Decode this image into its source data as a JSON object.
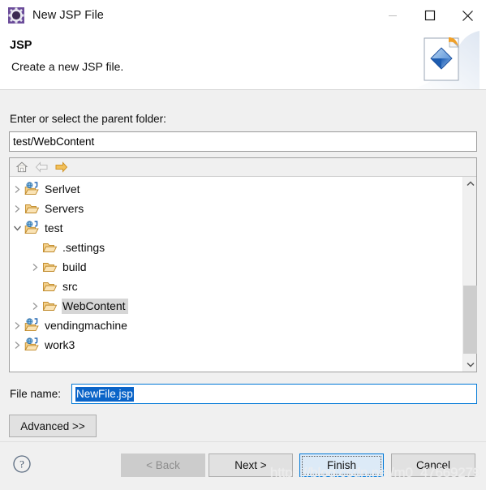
{
  "window": {
    "title": "New JSP File",
    "icon": "jsp-wizard-icon",
    "controls": [
      {
        "name": "minimize-button",
        "glyph": "minimize-icon",
        "enabled": false
      },
      {
        "name": "maximize-button",
        "glyph": "maximize-icon",
        "enabled": true
      },
      {
        "name": "close-button",
        "glyph": "close-icon",
        "enabled": true
      }
    ]
  },
  "banner": {
    "title": "JSP",
    "subtitle": "Create a new JSP file.",
    "icon": "jsp-file-banner-icon"
  },
  "form": {
    "parent_folder_label": "Enter or select the parent folder:",
    "parent_folder_value": "test/WebContent",
    "parent_folder_placeholder": "",
    "file_name_label": "File name:",
    "file_name_value": "NewFile.jsp",
    "file_name_placeholder": "",
    "advanced_label": "Advanced >>"
  },
  "tree": {
    "toolbar": [
      {
        "name": "home-icon",
        "label": "Home",
        "enabled": true
      },
      {
        "name": "back-arrow-icon",
        "label": "Back",
        "enabled": false
      },
      {
        "name": "forward-arrow-icon",
        "label": "Forward",
        "enabled": true
      }
    ],
    "nodes": [
      {
        "label": "Serlvet",
        "indent": 0,
        "twisty": "collapsed",
        "icon": "web-project-icon",
        "selected": false
      },
      {
        "label": "Servers",
        "indent": 0,
        "twisty": "collapsed",
        "icon": "folder-icon",
        "selected": false
      },
      {
        "label": "test",
        "indent": 0,
        "twisty": "expanded",
        "icon": "web-project-icon",
        "selected": false
      },
      {
        "label": ".settings",
        "indent": 1,
        "twisty": "none",
        "icon": "folder-icon",
        "selected": false
      },
      {
        "label": "build",
        "indent": 1,
        "twisty": "collapsed",
        "icon": "folder-icon",
        "selected": false
      },
      {
        "label": "src",
        "indent": 1,
        "twisty": "none",
        "icon": "folder-icon",
        "selected": false
      },
      {
        "label": "WebContent",
        "indent": 1,
        "twisty": "collapsed",
        "icon": "folder-icon",
        "selected": true
      },
      {
        "label": "vendingmachine",
        "indent": 0,
        "twisty": "collapsed",
        "icon": "web-project-icon",
        "selected": false
      },
      {
        "label": "work3",
        "indent": 0,
        "twisty": "collapsed",
        "icon": "web-project-icon",
        "selected": false
      }
    ],
    "scrollbar": {
      "up": "scroll-up-icon",
      "down": "scroll-down-icon"
    }
  },
  "footer": {
    "help": "?",
    "buttons": [
      {
        "name": "back-button",
        "label": "< Back",
        "enabled": false,
        "default": false
      },
      {
        "name": "next-button",
        "label": "Next >",
        "enabled": true,
        "default": false
      },
      {
        "name": "finish-button",
        "label": "Finish",
        "enabled": true,
        "default": true
      },
      {
        "name": "cancel-button",
        "label": "Cancel",
        "enabled": true,
        "default": false
      }
    ]
  },
  "watermark": "https://blog.csdn.net/m0_47669279",
  "colors": {
    "accent": "#0078d7",
    "selection": "#0a64c8",
    "dialog_bg": "#f0f0f0",
    "tree_selection": "#d6d6d6",
    "folder": "#e8a33d",
    "default_button_fill": "#dceaf7"
  }
}
